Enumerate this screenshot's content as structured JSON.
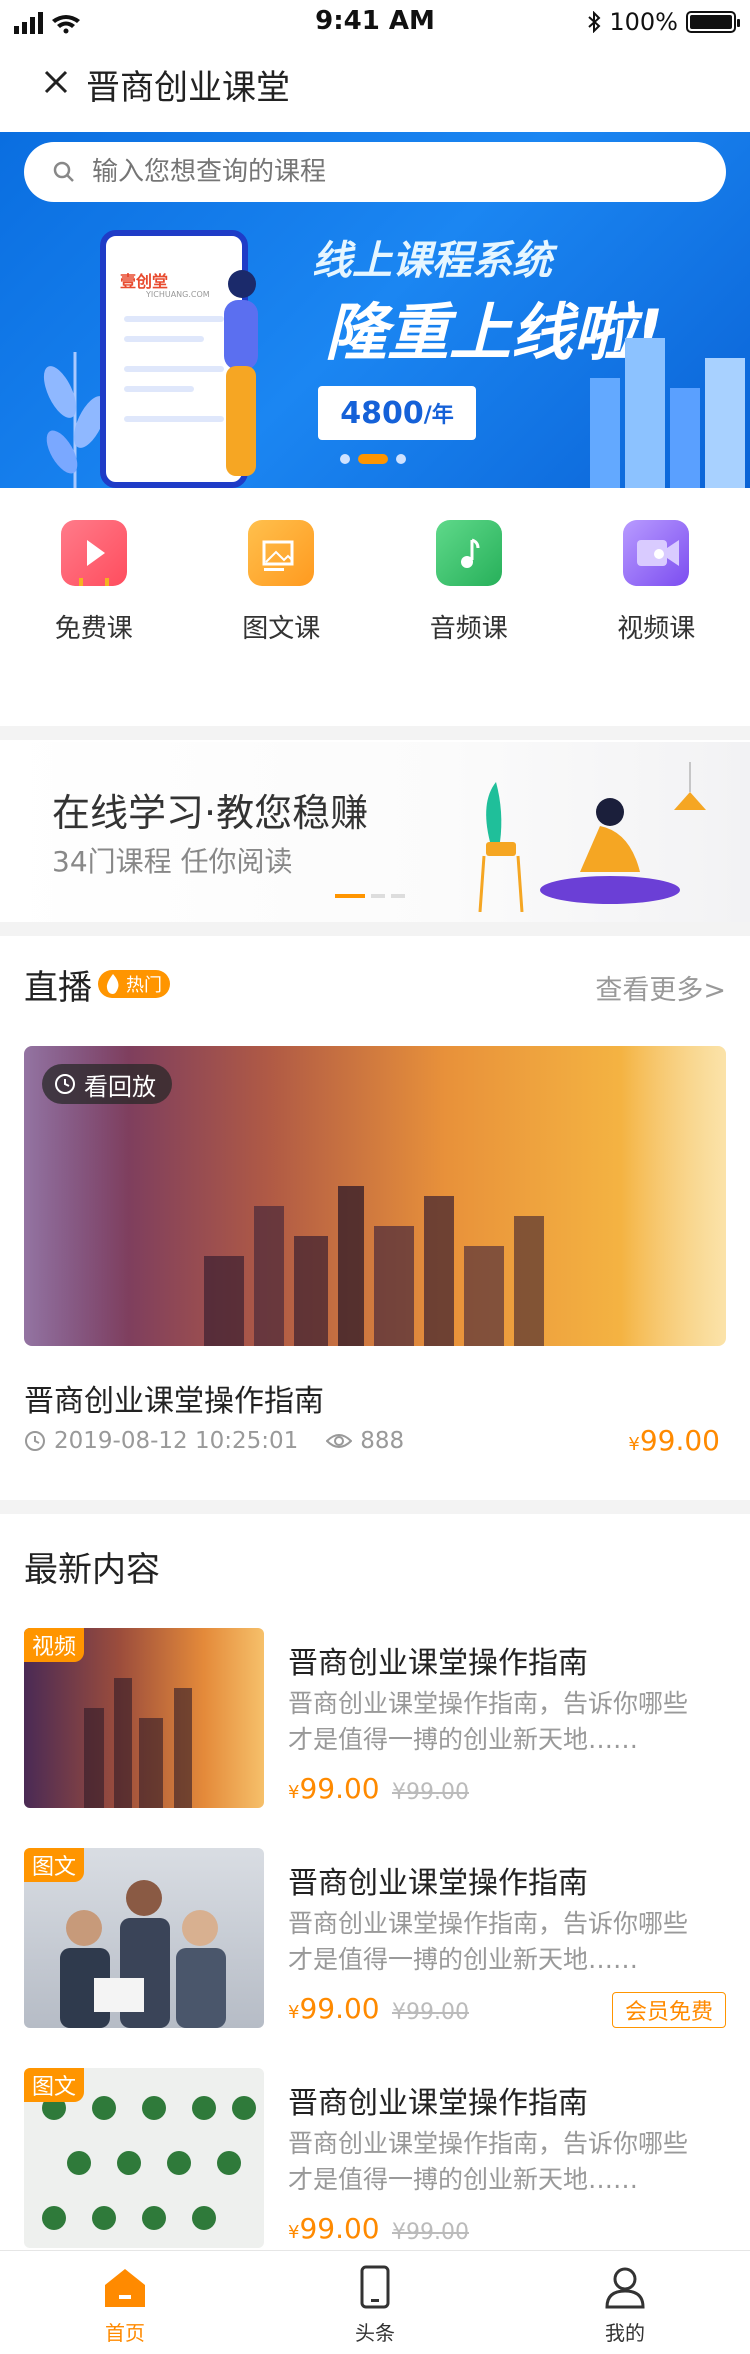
{
  "status_bar": {
    "time": "9:41 AM",
    "battery": "100%"
  },
  "nav": {
    "title": "晋商创业课堂"
  },
  "search": {
    "placeholder": "输入您想查询的课程"
  },
  "banner": {
    "headline": "线上课程系统",
    "slogan": "隆重上线啦!",
    "price": "4800",
    "price_unit": "/年",
    "phone_logo": "壹创堂",
    "phone_logo_sub": "YICHUANG.COM"
  },
  "categories": [
    {
      "label": "免费课",
      "icon": "free-course-icon",
      "color": "#ff5a6e"
    },
    {
      "label": "图文课",
      "icon": "image-text-course-icon",
      "color": "#ffa42b"
    },
    {
      "label": "音频课",
      "icon": "audio-course-icon",
      "color": "#3cc26b"
    },
    {
      "label": "视频课",
      "icon": "video-course-icon",
      "color": "#8a5cf6"
    }
  ],
  "promo": {
    "headline": "在线学习·教您稳赚",
    "subtitle": "34门课程  任你阅读"
  },
  "live": {
    "section_title": "直播",
    "hot_badge": "热门",
    "more_link": "查看更多>",
    "replay_label": "看回放",
    "title": "晋商创业课堂操作指南",
    "datetime": "2019-08-12 10:25:01",
    "views": "888",
    "price_symbol": "¥",
    "price": "99.00"
  },
  "latest": {
    "section_title": "最新内容",
    "items": [
      {
        "tag": "视频",
        "title": "晋商创业课堂操作指南",
        "desc": "晋商创业课堂操作指南，告诉你哪些才是值得一搏的创业新天地……",
        "price": "99.00",
        "original_price": "¥99.00",
        "member_badge": ""
      },
      {
        "tag": "图文",
        "title": "晋商创业课堂操作指南",
        "desc": "晋商创业课堂操作指南，告诉你哪些才是值得一搏的创业新天地……",
        "price": "99.00",
        "original_price": "¥99.00",
        "member_badge": "会员免费"
      },
      {
        "tag": "图文",
        "title": "晋商创业课堂操作指南",
        "desc": "晋商创业课堂操作指南，告诉你哪些才是值得一搏的创业新天地……",
        "price": "99.00",
        "original_price": "¥99.00",
        "member_badge": ""
      }
    ]
  },
  "tabbar": [
    {
      "label": "首页",
      "icon": "home-icon",
      "active": true
    },
    {
      "label": "头条",
      "icon": "phone-icon",
      "active": false
    },
    {
      "label": "我的",
      "icon": "user-icon",
      "active": false
    }
  ],
  "colors": {
    "accent": "#ff9500",
    "price": "#ff8a00",
    "banner": "#1b86f2"
  }
}
